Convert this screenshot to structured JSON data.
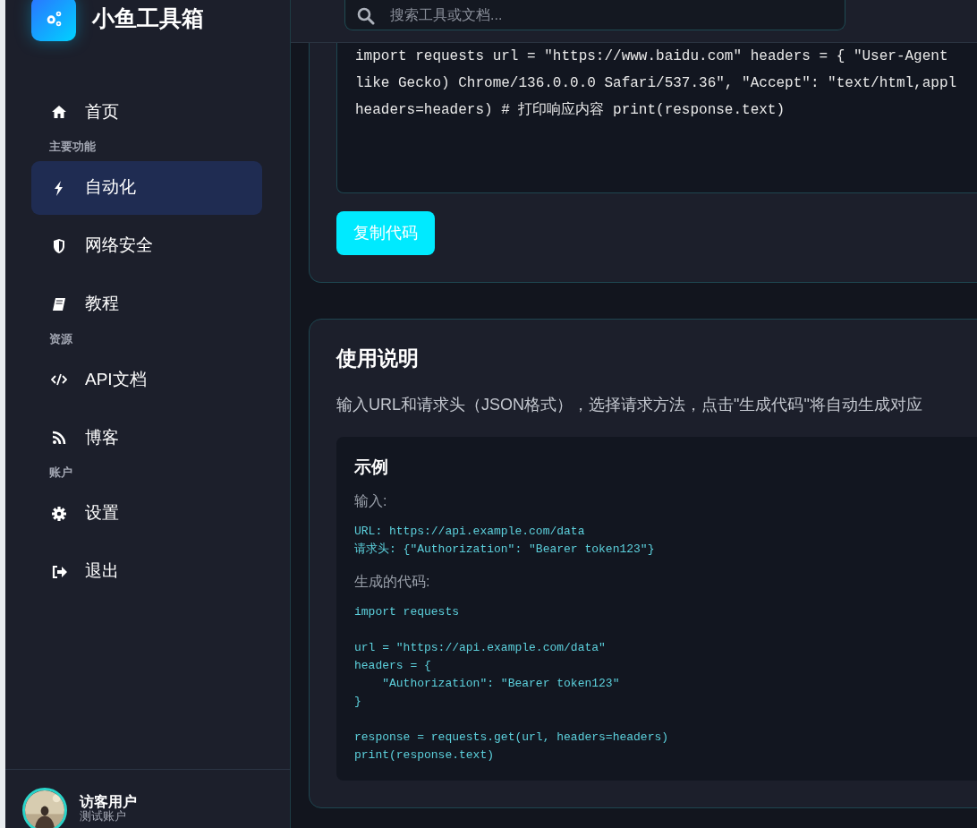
{
  "app": {
    "title": "小鱼工具箱"
  },
  "sidebar": {
    "items": [
      {
        "kind": "link",
        "label": "首页",
        "selected": false
      },
      {
        "kind": "section",
        "label": "主要功能"
      },
      {
        "kind": "link",
        "label": "自动化",
        "selected": true
      },
      {
        "kind": "link",
        "label": "网络安全",
        "selected": false
      },
      {
        "kind": "link",
        "label": "教程",
        "selected": false
      },
      {
        "kind": "section",
        "label": "资源"
      },
      {
        "kind": "link",
        "label": "API文档",
        "selected": false
      },
      {
        "kind": "link",
        "label": "博客",
        "selected": false
      },
      {
        "kind": "section",
        "label": "账户"
      },
      {
        "kind": "link",
        "label": "设置",
        "selected": false
      },
      {
        "kind": "link",
        "label": "退出",
        "selected": false
      }
    ],
    "user": {
      "name": "访客用户",
      "role": "测试账户"
    }
  },
  "search": {
    "placeholder": "搜索工具或文档..."
  },
  "generated_code": {
    "lines": [
      "import requests url = \"https://www.baidu.com\" headers = { \"User-Agent",
      "like Gecko) Chrome/136.0.0.0 Safari/537.36\", \"Accept\": \"text/html,appl",
      "headers=headers) # 打印响应内容 print(response.text)"
    ],
    "copy_button": "复制代码"
  },
  "instructions": {
    "title": "使用说明",
    "text": "输入URL和请求头（JSON格式），选择请求方法，点击\"生成代码\"将自动生成对应",
    "example": {
      "title": "示例",
      "input_label": "输入:",
      "input_code": "URL: https://api.example.com/data\n请求头: {\"Authorization\": \"Bearer token123\"}",
      "output_label": "生成的代码:",
      "output_code": "import requests\n\nurl = \"https://api.example.com/data\"\nheaders = {\n    \"Authorization\": \"Bearer token123\"\n}\n\nresponse = requests.get(url, headers=headers)\nprint(response.text)"
    }
  }
}
